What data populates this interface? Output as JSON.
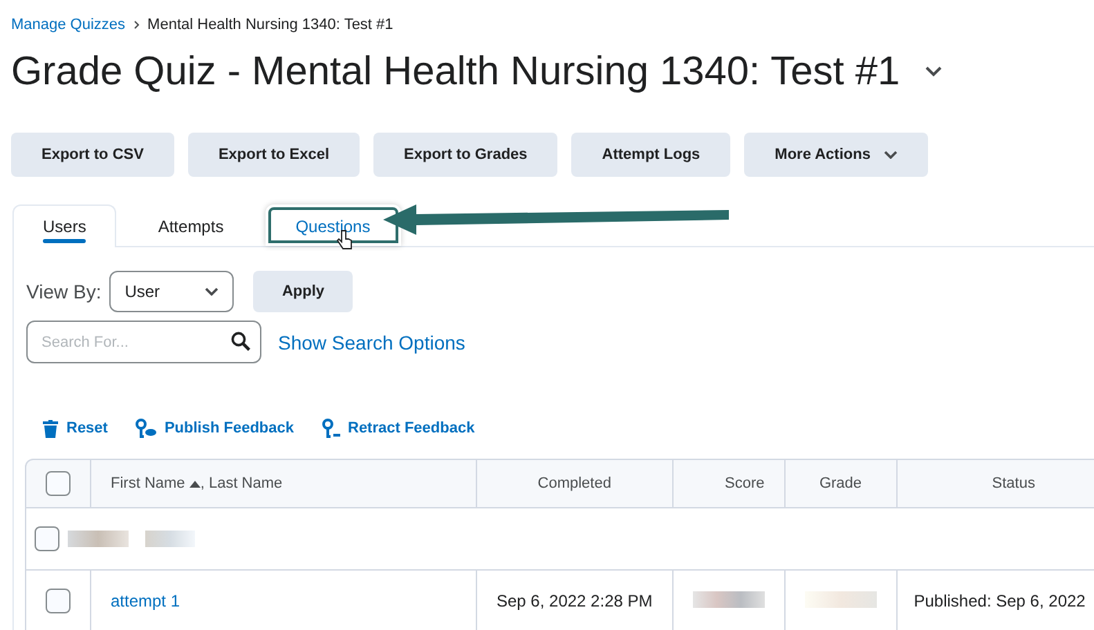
{
  "breadcrumb": {
    "link": "Manage Quizzes",
    "current": "Mental Health Nursing 1340: Test #1"
  },
  "title": "Grade Quiz - Mental Health Nursing 1340: Test #1",
  "buttons": [
    {
      "label": "Export to CSV",
      "kind": "plain"
    },
    {
      "label": "Export to Excel",
      "kind": "plain"
    },
    {
      "label": "Export to Grades",
      "kind": "plain"
    },
    {
      "label": "Attempt Logs",
      "kind": "plain"
    },
    {
      "label": "More Actions",
      "kind": "menu"
    }
  ],
  "tabs": [
    {
      "label": "Users",
      "selected": true,
      "callout": false
    },
    {
      "label": "Attempts",
      "selected": false,
      "callout": false
    },
    {
      "label": "Questions",
      "selected": false,
      "callout": true
    }
  ],
  "view_by": {
    "label": "View By:",
    "value": "User",
    "apply": "Apply"
  },
  "search": {
    "placeholder": "Search For...",
    "options_link": "Show Search Options"
  },
  "actions": [
    {
      "label": "Reset",
      "kind": "trash"
    },
    {
      "label": "Publish Feedback",
      "kind": "publish"
    },
    {
      "label": "Retract Feedback",
      "kind": "retract"
    }
  ],
  "table": {
    "select_all_checked": false,
    "columns": [
      "First Name",
      "Completed",
      "Score",
      "Grade",
      "Status"
    ],
    "name_column_second": ", Last Name",
    "rows": [
      {
        "kind": "group",
        "checked": false
      },
      {
        "kind": "attempt",
        "checked": false,
        "name": "attempt 1",
        "completed": "Sep 6, 2022 2:28 PM",
        "status": "Published: Sep 6, 2022"
      }
    ]
  }
}
